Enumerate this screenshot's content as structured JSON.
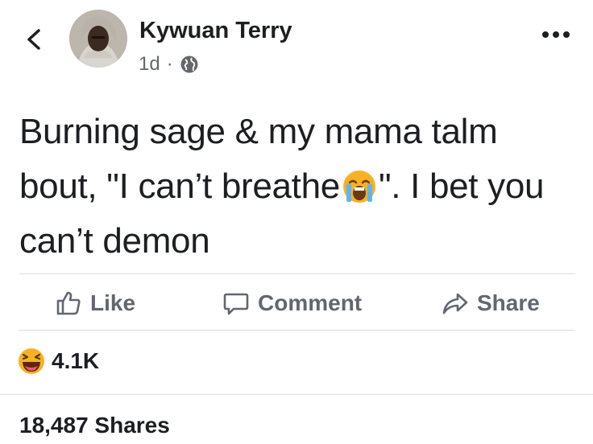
{
  "post": {
    "author_name": "Kywuan Terry",
    "time_ago": "1d",
    "separator": "·",
    "privacy_icon": "globe-icon",
    "text_part1": "Burning sage & my mama talm bout, \"I can’t breathe",
    "text_part2": "\". I bet you can’t demon",
    "inline_emoji": "loudly-crying-face-emoji"
  },
  "actions": {
    "like_label": "Like",
    "comment_label": "Comment",
    "share_label": "Share"
  },
  "reactions": {
    "emoji": "laughing-face-emoji",
    "count": "4.1K"
  },
  "shares": {
    "label": "18,487 Shares"
  },
  "colors": {
    "text_primary": "#1c1e21",
    "text_secondary": "#65676b",
    "action_gray": "#606770",
    "divider": "#dadde1",
    "emoji_yellow": "#f7b125"
  }
}
